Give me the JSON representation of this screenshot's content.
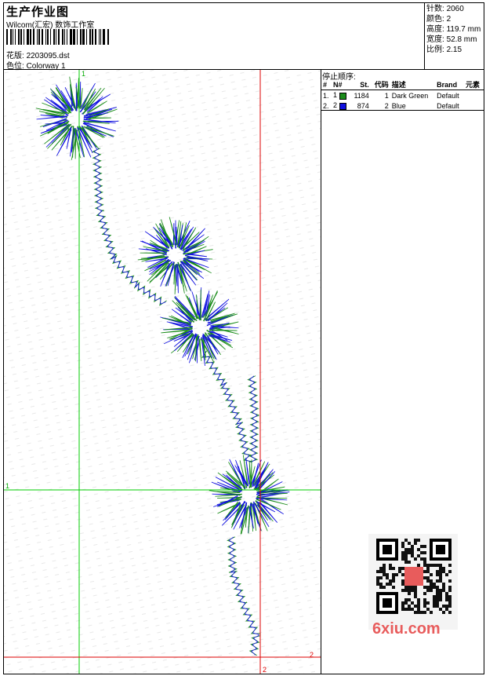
{
  "header": {
    "title": "生产作业图",
    "studio": "Wilcom(汇宏) 数饰工作室",
    "design_file": {
      "label": "花版:",
      "value": "2203095.dst"
    },
    "colorway": {
      "label": "色位:",
      "value": "Colorway 1"
    }
  },
  "stats": [
    {
      "label": "针数:",
      "value": "2060"
    },
    {
      "label": "颜色:",
      "value": "2"
    },
    {
      "label": "高度:",
      "value": "119.7 mm"
    },
    {
      "label": "宽度:",
      "value": "52.8 mm"
    },
    {
      "label": "比例:",
      "value": "2.15"
    }
  ],
  "stop_sequence": {
    "label": "停止顺序:",
    "columns": [
      "#",
      "N#",
      "St.",
      "代码",
      "描述",
      "Brand",
      "元素"
    ],
    "rows": [
      {
        "index": "1.",
        "needle": "1",
        "color": "#1a8c1a",
        "stitches": "1184",
        "code": "1",
        "description": "Dark Green",
        "brand": "Default",
        "element": ""
      },
      {
        "index": "2.",
        "needle": "2",
        "color": "#1010e0",
        "stitches": "874",
        "code": "2",
        "description": "Blue",
        "brand": "Default",
        "element": ""
      }
    ]
  },
  "axis_markers": {
    "green_top": "1",
    "green_left": "1",
    "red_right": "2",
    "red_bottom": "2"
  },
  "colors": {
    "green_thread": "#1a8c1a",
    "blue_thread": "#1010e0",
    "guide_green": "#00cc00",
    "guide_red": "#dd0000"
  },
  "watermark": "6xiu.com"
}
